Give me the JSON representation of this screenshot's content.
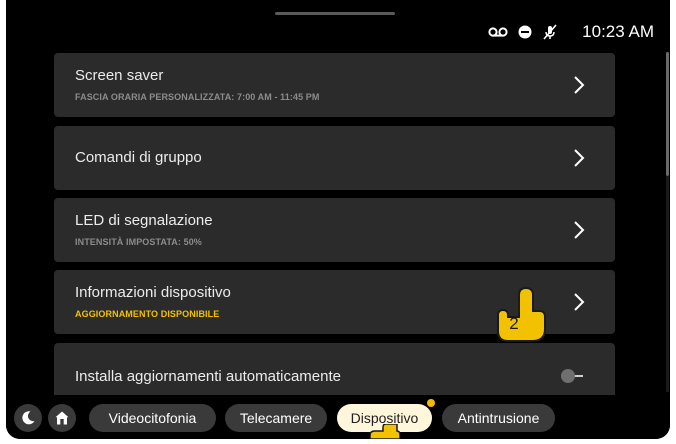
{
  "status": {
    "icons": [
      "voicemail-icon",
      "do-not-disturb-icon",
      "mic-off-icon"
    ],
    "time": "10:23 AM"
  },
  "settings": [
    {
      "title": "Screen saver",
      "subtitle": "FASCIA ORARIA PERSONALIZZATA: 7:00 AM - 11:45 PM"
    },
    {
      "title": "Comandi di gruppo"
    },
    {
      "title": "LED di segnalazione",
      "subtitle": "INTENSITÀ IMPOSTATA: 50%"
    },
    {
      "title": "Informazioni dispositivo",
      "subtitle": "AGGIORNAMENTO DISPONIBILE"
    },
    {
      "title": "Installa aggiornamenti automaticamente",
      "toggle": false
    }
  ],
  "nav": {
    "icons": [
      "moon-icon",
      "home-icon"
    ],
    "tabs": [
      {
        "label": "Videocitofonia"
      },
      {
        "label": "Telecamere"
      },
      {
        "label": "Dispositivo",
        "active": true
      },
      {
        "label": "Antintrusione"
      }
    ]
  },
  "hint": {
    "step": "2"
  },
  "colors": {
    "background": "#000000",
    "row": "#2b2b2b",
    "warning": "#f2c200",
    "active_tab": "#fff6dc",
    "hand": "#f2c200"
  }
}
